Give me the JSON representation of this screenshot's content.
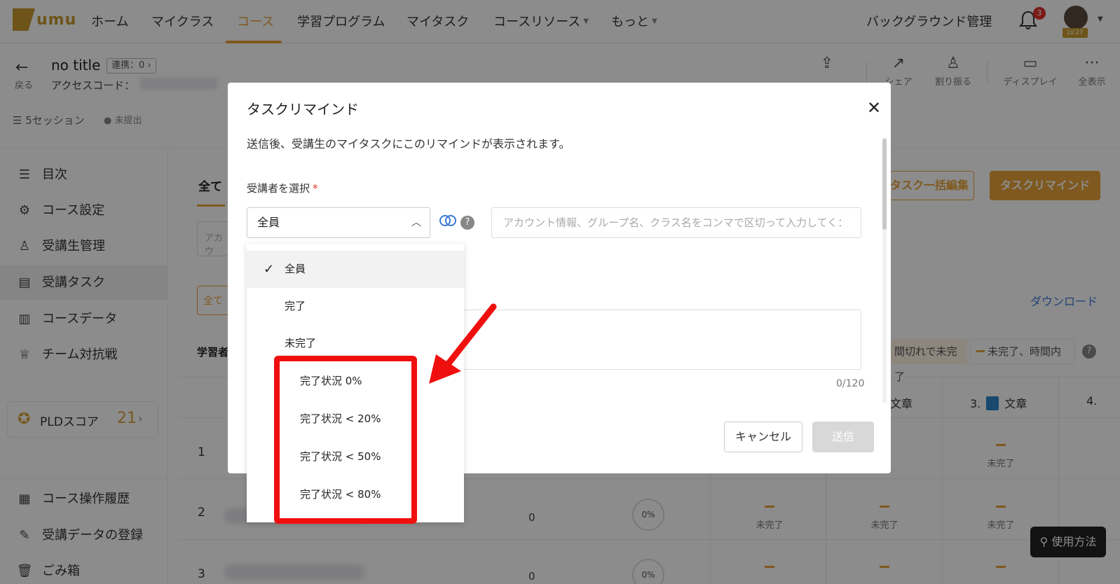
{
  "brand": {
    "logo_text": "umu",
    "accent": "#e8a33a"
  },
  "topnav": {
    "items": [
      "ホーム",
      "マイクラス",
      "コース",
      "学習プログラム",
      "マイタスク",
      "コースリソース",
      "もっと"
    ],
    "active": "コース",
    "admin_label": "バックグラウンド管理",
    "notification_count": "3",
    "level_badge": "LV.27"
  },
  "course": {
    "back_label": "戻る",
    "title": "no title",
    "link_label": "連携：0",
    "access_code_label": "アクセスコード：",
    "sessions": "5セッション",
    "status": "未提出"
  },
  "toolbar": {
    "share": "シェア",
    "assign": "割り振る",
    "display": "ディスプレイ",
    "show_all": "全表示"
  },
  "sidebar": {
    "items": [
      "目次",
      "コース設定",
      "受講生管理",
      "受講タスク",
      "コースデータ",
      "チーム対抗戦"
    ],
    "pld_label": "PLDスコア",
    "pld_score": "21",
    "bottom_items": [
      "コース操作履歴",
      "受講データの登録",
      "ごみ箱"
    ]
  },
  "main": {
    "tab_all": "全て",
    "input_hint": "アカウ",
    "btn_all": "全て",
    "learner_header": "学習者",
    "bulk_edit": "タスク一括編集",
    "task_remind": "タスクリマインド",
    "download": "ダウンロード",
    "legend_overdue": "間切れで未完了",
    "legend_pending": "未完了、時間内",
    "col_doc": "文章",
    "col3_num": "3.",
    "col3_label": "文章",
    "col4_num": "4.",
    "rows": [
      "1",
      "2",
      "3"
    ],
    "status_incomplete": "未完了",
    "zero": "0",
    "percent": "0%",
    "howto": "使用方法"
  },
  "modal": {
    "title": "タスクリマインド",
    "description": "送信後、受講生のマイタスクにこのリマインドが表示されます。",
    "select_label": "受講者を選択",
    "required_mark": "*",
    "selected_value": "全員",
    "input_placeholder": "アカウント情報、グループ名、クラス名をコンマで区切って入力してく：",
    "counter": "0/120",
    "cancel": "キャンセル",
    "submit": "送信"
  },
  "dropdown": {
    "options": [
      "全員",
      "完了",
      "未完了",
      "完了状況 0%",
      "完了状況 < 20%",
      "完了状況 < 50%",
      "完了状況 < 80%"
    ],
    "selected": "全員"
  },
  "annotation": {
    "highlight_color": "#f00f0f"
  }
}
